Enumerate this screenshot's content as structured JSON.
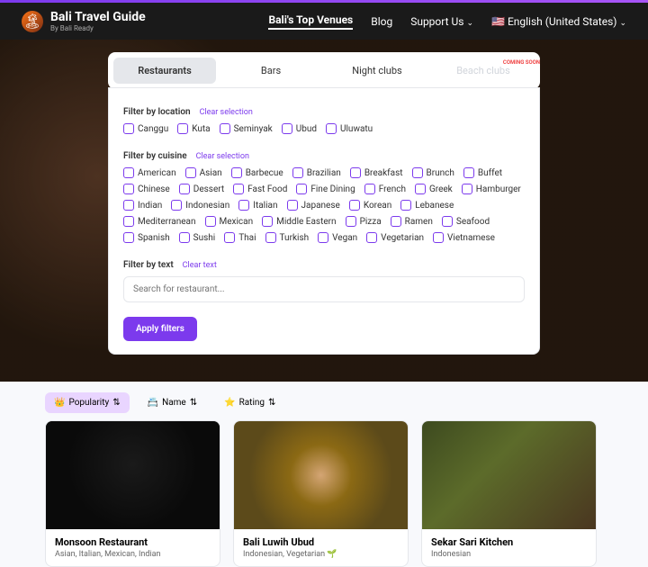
{
  "header": {
    "title": "Bali Travel Guide",
    "subtitle": "By Bali Ready",
    "nav": {
      "venues": "Bali's Top Venues",
      "blog": "Blog",
      "support": "Support Us",
      "lang": "English (United States)"
    }
  },
  "tabs": {
    "restaurants": "Restaurants",
    "bars": "Bars",
    "night": "Night clubs",
    "beach": "Beach clubs",
    "soon": "COMING SOON"
  },
  "filters": {
    "location": {
      "label": "Filter by location",
      "clear": "Clear selection",
      "items": [
        "Canggu",
        "Kuta",
        "Seminyak",
        "Ubud",
        "Uluwatu"
      ]
    },
    "cuisine": {
      "label": "Filter by cuisine",
      "clear": "Clear selection",
      "items": [
        "American",
        "Asian",
        "Barbecue",
        "Brazilian",
        "Breakfast",
        "Brunch",
        "Buffet",
        "Chinese",
        "Dessert",
        "Fast Food",
        "Fine Dining",
        "French",
        "Greek",
        "Hamburger",
        "Indian",
        "Indonesian",
        "Italian",
        "Japanese",
        "Korean",
        "Lebanese",
        "Mediterranean",
        "Mexican",
        "Middle Eastern",
        "Pizza",
        "Ramen",
        "Seafood",
        "Spanish",
        "Sushi",
        "Thai",
        "Turkish",
        "Vegan",
        "Vegetarian",
        "Vietnamese"
      ]
    },
    "text": {
      "label": "Filter by text",
      "clear": "Clear text",
      "placeholder": "Search for restaurant..."
    },
    "apply": "Apply filters"
  },
  "sorts": {
    "pop": "Popularity",
    "name": "Name",
    "rating": "Rating"
  },
  "cards": [
    {
      "title": "Monsoon Restaurant",
      "sub": "Asian, Italian, Mexican, Indian"
    },
    {
      "title": "Bali Luwih Ubud",
      "sub": "Indonesian, Vegetarian 🌱"
    },
    {
      "title": "Sekar Sari Kitchen",
      "sub": "Indonesian"
    }
  ]
}
